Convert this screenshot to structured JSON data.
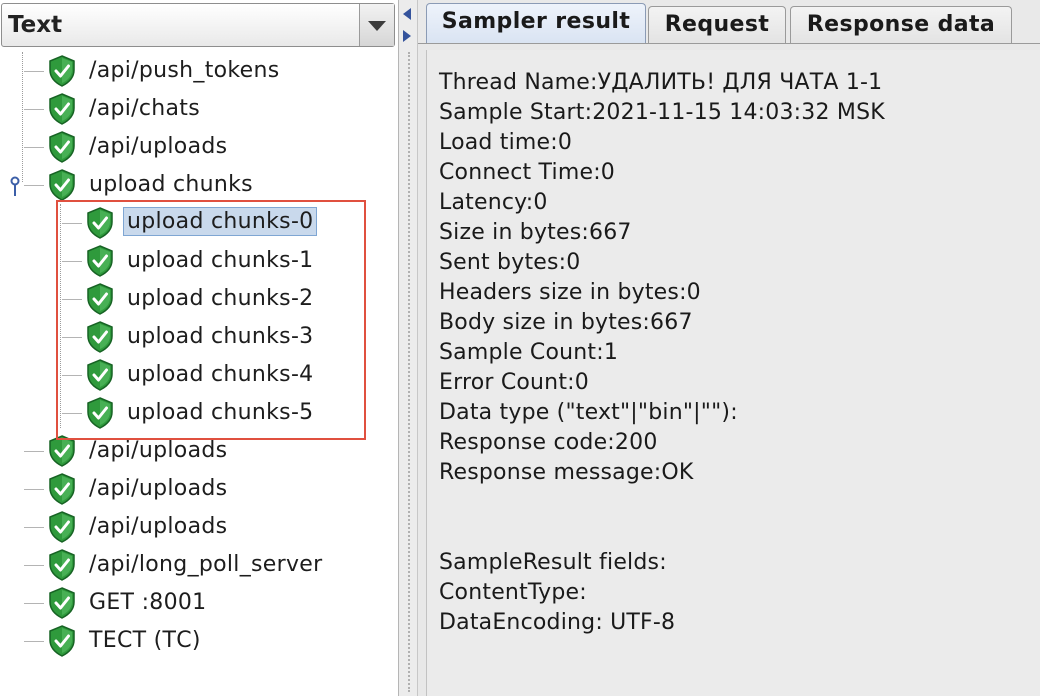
{
  "combo": {
    "value": "Text"
  },
  "tree": {
    "items": [
      {
        "label": "/api/push_tokens"
      },
      {
        "label": "/api/chats"
      },
      {
        "label": "/api/uploads"
      },
      {
        "label": "upload chunks"
      },
      {
        "label": "upload chunks-0"
      },
      {
        "label": "upload chunks-1"
      },
      {
        "label": "upload chunks-2"
      },
      {
        "label": "upload chunks-3"
      },
      {
        "label": "upload chunks-4"
      },
      {
        "label": "upload chunks-5"
      },
      {
        "label": "/api/uploads"
      },
      {
        "label": "/api/uploads"
      },
      {
        "label": "/api/uploads"
      },
      {
        "label": "/api/long_poll_server"
      },
      {
        "label": "GET :8001"
      },
      {
        "label": "ТЕСТ (ТС)"
      }
    ]
  },
  "tabs": [
    {
      "label": "Sampler result"
    },
    {
      "label": "Request"
    },
    {
      "label": "Response data"
    }
  ],
  "result": {
    "lines": [
      "Thread Name:УДАЛИТЬ! ДЛЯ ЧАТА  1-1",
      "Sample Start:2021-11-15 14:03:32 MSK",
      "Load time:0",
      "Connect Time:0",
      "Latency:0",
      "Size in bytes:667",
      "Sent bytes:0",
      "Headers size in bytes:0",
      "Body size in bytes:667",
      "Sample Count:1",
      "Error Count:0",
      "Data type (\"text\"|\"bin\"|\"\"):",
      "Response code:200",
      "Response message:OK",
      "",
      "",
      "SampleResult fields:",
      "ContentType:",
      "DataEncoding: UTF-8"
    ]
  },
  "colors": {
    "success_icon": "#2f9a3c",
    "selection": "#c9d9ec",
    "highlight_box": "#e0503f"
  }
}
